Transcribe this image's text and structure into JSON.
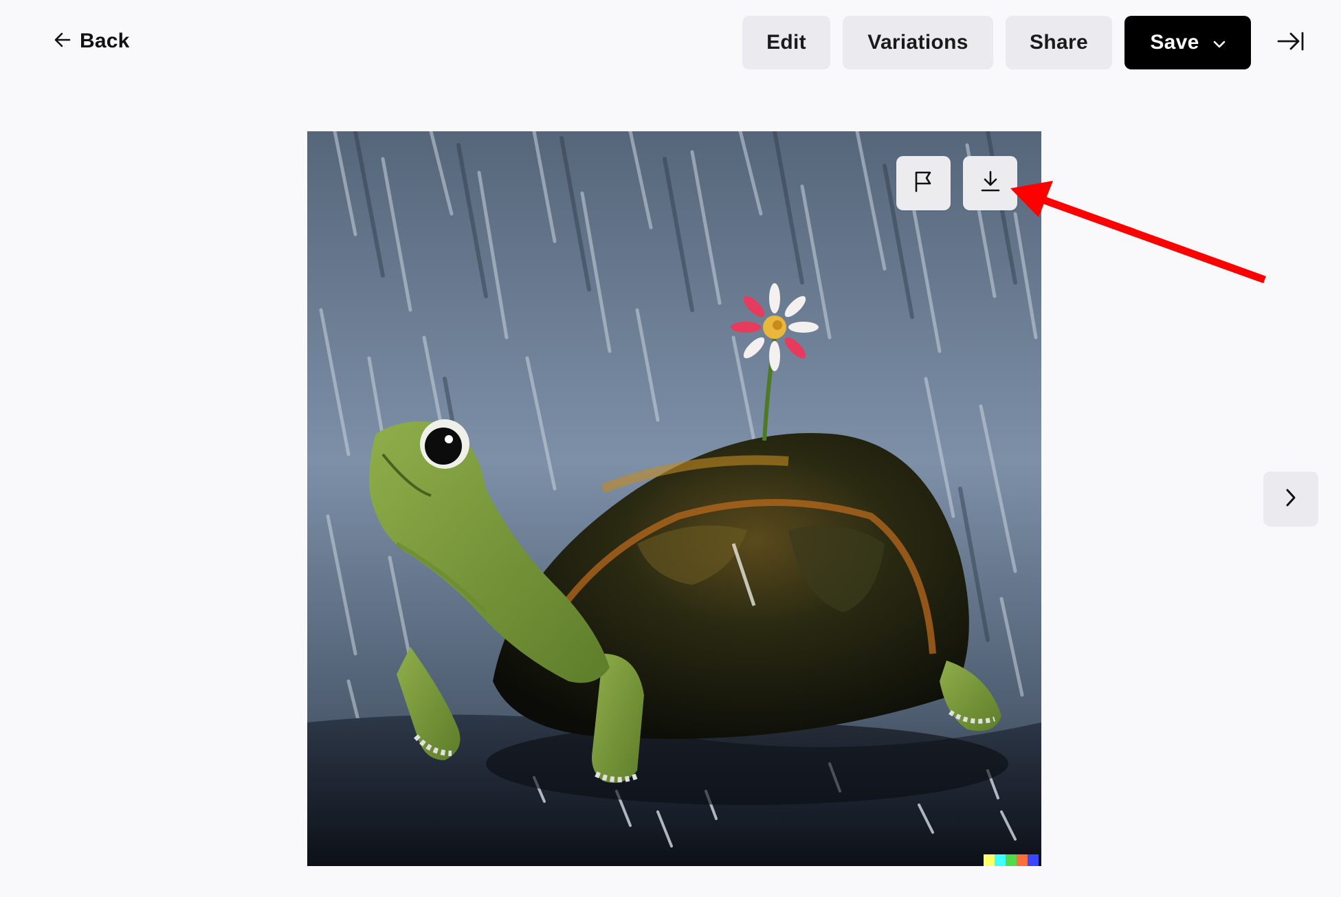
{
  "header": {
    "back_label": "Back",
    "edit_label": "Edit",
    "variations_label": "Variations",
    "share_label": "Share",
    "save_label": "Save",
    "icons": {
      "back": "arrow-left-icon",
      "save_dropdown": "chevron-down-icon",
      "collapse_panel": "arrow-right-to-bar-icon"
    }
  },
  "image": {
    "subject": "turtle with a daisy on its shell in the rain, painting",
    "actions": {
      "report": "flag-icon",
      "download": "download-icon"
    },
    "signature_colors": [
      "#ffff66",
      "#42ffff",
      "#51da4c",
      "#ff6e3c",
      "#3c46ff"
    ]
  },
  "navigation": {
    "next": "chevron-right-icon"
  },
  "annotation": {
    "type": "red-arrow",
    "color": "#ff0000",
    "points_to": "download-button"
  },
  "colors": {
    "page_background": "#f9f9fb",
    "secondary_button": "#ebebef",
    "primary_button": "#000000",
    "primary_button_text": "#ffffff"
  }
}
